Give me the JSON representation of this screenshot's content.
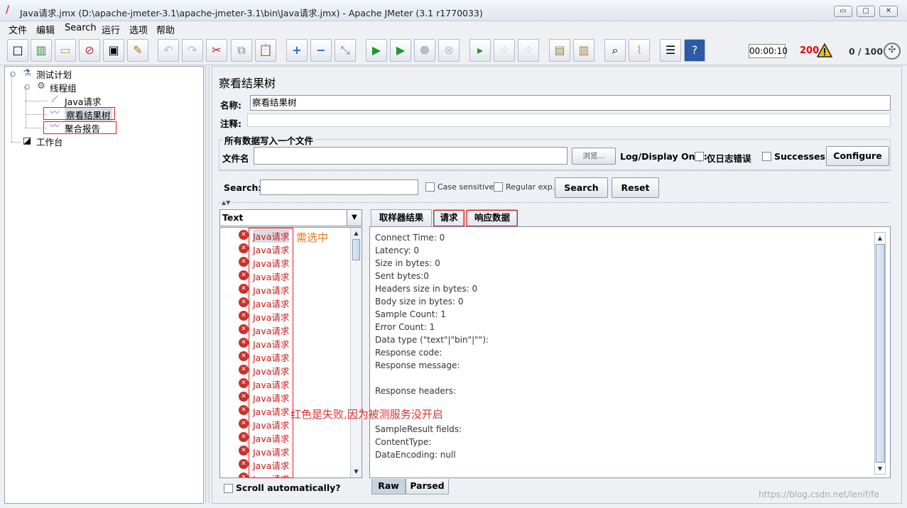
{
  "window": {
    "title": "Java请求.jmx (D:\\apache-jmeter-3.1\\apache-jmeter-3.1\\bin\\Java请求.jmx) - Apache JMeter (3.1 r1770033)",
    "minimize": "▭",
    "maximize": "▢",
    "close": "✕"
  },
  "menu": [
    "文件",
    "编辑",
    "Search",
    "运行",
    "选项",
    "帮助"
  ],
  "toolbar": {
    "timer": "00:00:10",
    "error_count": "200",
    "threads": "0 / 100"
  },
  "tree": {
    "items": [
      {
        "label": "测试计划",
        "icon": "test-plan-icon"
      },
      {
        "label": "线程组",
        "icon": "gear-icon"
      },
      {
        "label": "Java请求",
        "icon": "pipette-icon"
      },
      {
        "label": "察看结果树",
        "icon": "graph-icon"
      },
      {
        "label": "聚合报告",
        "icon": "graph-icon"
      },
      {
        "label": "工作台",
        "icon": "workbench-icon"
      }
    ]
  },
  "main": {
    "title": "察看结果树",
    "name_label": "名称:",
    "name_value": "察看结果树",
    "comment_label": "注释:",
    "comment_value": "",
    "file_group_title": "所有数据写入一个文件",
    "file_label": "文件名",
    "file_value": "",
    "browse_label": "浏览...",
    "log_display_label": "Log/Display Only:",
    "errors_only_label": "仅日志错误",
    "successes_label": "Successes",
    "configure_label": "Configure",
    "search_label": "Search:",
    "search_value": "",
    "case_sensitive_label": "Case sensitive",
    "regex_label": "Regular exp.",
    "search_button": "Search",
    "reset_button": "Reset"
  },
  "results": {
    "renderer": "Text",
    "item_label": "Java请求",
    "visible_count": 19,
    "scroll_auto_label": "Scroll automatically?"
  },
  "tabs": [
    "取样器结果",
    "请求",
    "响应数据"
  ],
  "bottom_tabs": [
    "Raw",
    "Parsed"
  ],
  "detail_lines": [
    "Connect Time: 0",
    "Latency: 0",
    "Size in bytes: 0",
    "Sent bytes:0",
    "Headers size in bytes: 0",
    "Body size in bytes: 0",
    "Sample Count: 1",
    "Error Count: 1",
    "Data type (\"text\"|\"bin\"|\"\"):",
    "Response code:",
    "Response message:",
    "",
    "Response headers:",
    "",
    "",
    "SampleResult fields:",
    "ContentType:",
    "DataEncoding: null"
  ],
  "annotations": {
    "selected_note": "需选中",
    "failure_note": "红色是失败,因为被测服务没开启"
  },
  "watermark": "https://blog.csdn.net/lenif/fe",
  "colors": {
    "error": "#d01818",
    "annotation": "#e03030",
    "highlight_box": "#e02020"
  }
}
